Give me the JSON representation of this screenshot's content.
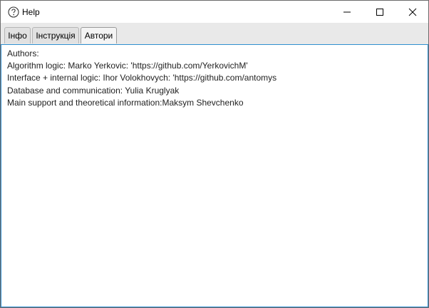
{
  "window": {
    "title": "Help",
    "icon": "help-circle-icon",
    "controls": {
      "minimize": "minimize-icon",
      "maximize": "maximize-icon",
      "close": "close-icon"
    }
  },
  "tabs": [
    {
      "label": "Інфо",
      "selected": false
    },
    {
      "label": "Інструкція",
      "selected": false
    },
    {
      "label": "Автори",
      "selected": true
    }
  ],
  "content": {
    "lines": [
      "Authors:",
      "Algorithm logic: Marko Yerkovic: 'https://github.com/YerkovichM'",
      "Interface + internal logic: Ihor Volokhovych: 'https://github.com/antomys",
      "Database and communication: Yulia Kruglyak",
      "Main support and theoretical information:Maksym Shevchenko"
    ]
  },
  "colors": {
    "focus_border": "#2f8fd0",
    "tabstrip_bg": "#e9e9e9"
  }
}
